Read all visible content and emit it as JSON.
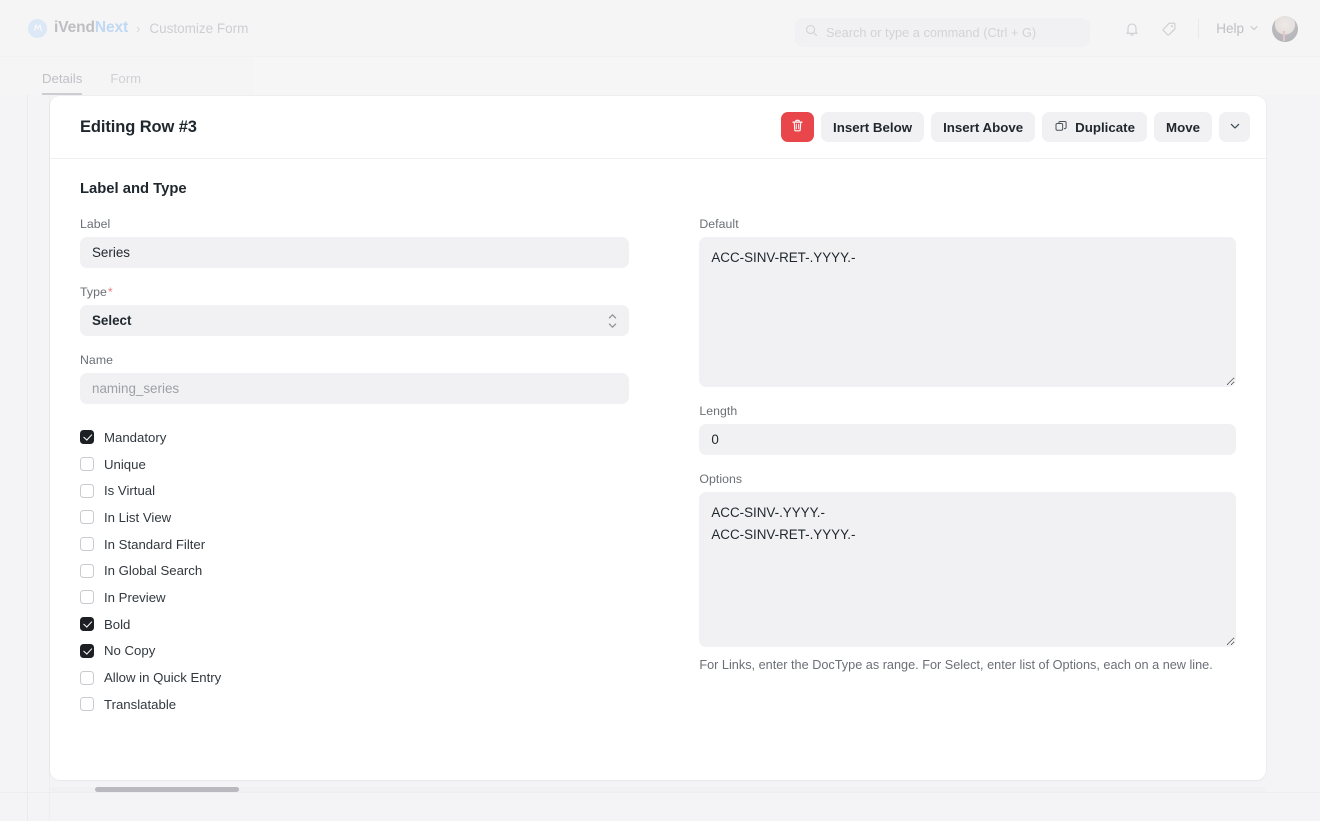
{
  "navbar": {
    "brand_prefix": "iVend",
    "brand_suffix": "Next",
    "brand_mark_glyph": "ⓜ",
    "breadcrumb_separator": "›",
    "breadcrumb": "Customize Form",
    "search_placeholder": "Search or type a command (Ctrl + G)",
    "search_value": "",
    "help_label": "Help",
    "icons": {
      "search": "search-icon",
      "notifications": "bell-icon",
      "tags": "tag-icon",
      "help_chevron": "chevron-down-icon",
      "avatar": "user-avatar"
    }
  },
  "tabs": [
    {
      "label": "Details",
      "active": true
    },
    {
      "label": "Form",
      "active": false
    }
  ],
  "card": {
    "title": "Editing Row #3",
    "toolbar": {
      "delete_label": "",
      "delete_icon": "trash-icon",
      "delete_color": "#e8464a",
      "insert_below_label": "Insert Below",
      "insert_above_label": "Insert Above",
      "duplicate_label": "Duplicate",
      "duplicate_icon": "copy-icon",
      "move_label": "Move",
      "more_icon": "chevron-down-icon"
    }
  },
  "form": {
    "section_title": "Label and Type",
    "label_field": {
      "label": "Label",
      "value": "Series",
      "placeholder": ""
    },
    "type_field": {
      "label": "Type",
      "required_marker": "*",
      "value": "Select"
    },
    "name_field": {
      "label": "Name",
      "value": "",
      "placeholder": "naming_series"
    },
    "default_field": {
      "label": "Default",
      "value": "ACC-SINV-RET-.YYYY.-"
    },
    "length_field": {
      "label": "Length",
      "value": "0"
    },
    "options_field": {
      "label": "Options",
      "value": "ACC-SINV-.YYYY.-\nACC-SINV-RET-.YYYY.-",
      "help_text": "For Links, enter the DocType as range. For Select, enter list of Options, each on a new line."
    },
    "checkboxes": [
      {
        "label": "Mandatory",
        "checked": true
      },
      {
        "label": "Unique",
        "checked": false
      },
      {
        "label": "Is Virtual",
        "checked": false
      },
      {
        "label": "In List View",
        "checked": false
      },
      {
        "label": "In Standard Filter",
        "checked": false
      },
      {
        "label": "In Global Search",
        "checked": false
      },
      {
        "label": "In Preview",
        "checked": false
      },
      {
        "label": "Bold",
        "checked": true
      },
      {
        "label": "No Copy",
        "checked": true
      },
      {
        "label": "Allow in Quick Entry",
        "checked": false
      },
      {
        "label": "Translatable",
        "checked": false
      }
    ]
  }
}
